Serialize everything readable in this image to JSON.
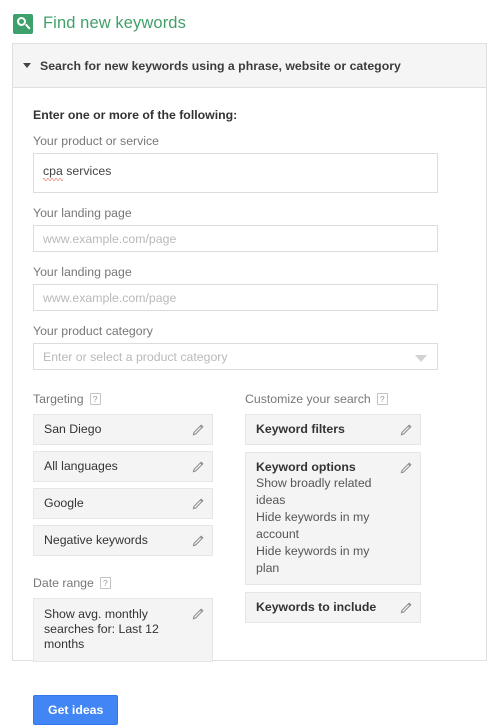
{
  "header": {
    "icon": "keyword-planner-search-icon",
    "title": "Find new keywords",
    "title_color": "#41a06a"
  },
  "panel": {
    "section_title": "Search for new keywords using a phrase, website or category",
    "collapse_icon": "caret-down-icon"
  },
  "form": {
    "intro": "Enter one or more of the following:",
    "product_or_service": {
      "label": "Your product or service",
      "value": "cpa services",
      "misspelled_word": "cpa",
      "rest": " services"
    },
    "landing_page_1": {
      "label": "Your landing page",
      "value": "",
      "placeholder": "www.example.com/page"
    },
    "landing_page_2": {
      "label": "Your landing page",
      "value": "",
      "placeholder": "www.example.com/page"
    },
    "product_category": {
      "label": "Your product category",
      "value": "",
      "placeholder": "Enter or select a product category",
      "arrow_icon": "dropdown-arrow-icon"
    }
  },
  "targeting": {
    "heading": "Targeting",
    "help_label": "?",
    "items": [
      {
        "label": "San Diego",
        "edit_icon": "pencil-icon"
      },
      {
        "label": "All languages",
        "edit_icon": "pencil-icon"
      },
      {
        "label": "Google",
        "edit_icon": "pencil-icon"
      },
      {
        "label": "Negative keywords",
        "edit_icon": "pencil-icon"
      }
    ]
  },
  "date_range": {
    "heading": "Date range",
    "help_label": "?",
    "value": "Show avg. monthly searches for: Last 12 months",
    "edit_icon": "pencil-icon"
  },
  "customize": {
    "heading": "Customize your search",
    "help_label": "?",
    "keyword_filters": {
      "title": "Keyword filters",
      "edit_icon": "pencil-icon"
    },
    "keyword_options": {
      "title": "Keyword options",
      "options": [
        "Show broadly related ideas",
        "Hide keywords in my account",
        "Hide keywords in my plan"
      ],
      "edit_icon": "pencil-icon"
    },
    "keywords_to_include": {
      "title": "Keywords to include",
      "edit_icon": "pencil-icon"
    }
  },
  "actions": {
    "get_ideas": "Get ideas",
    "button_color": "#4285f4"
  }
}
